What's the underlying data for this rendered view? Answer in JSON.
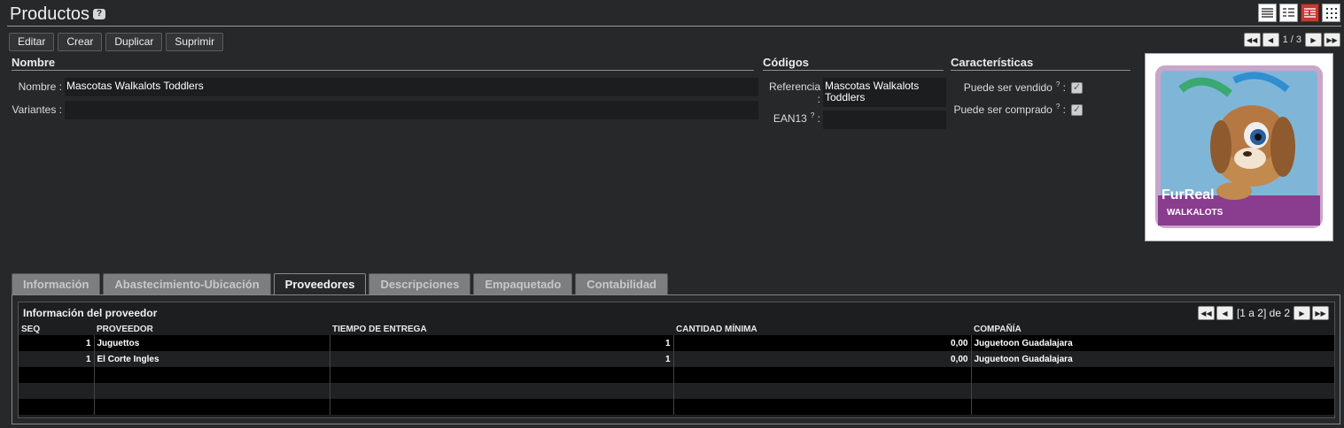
{
  "page": {
    "title": "Productos",
    "help": "?"
  },
  "toolbar": {
    "edit": "Editar",
    "create": "Crear",
    "duplicate": "Duplicar",
    "delete": "Suprimir"
  },
  "pager": {
    "text": "1 / 3"
  },
  "sections": {
    "name": "Nombre",
    "codes": "Códigos",
    "features": "Características"
  },
  "fields": {
    "name_label": "Nombre :",
    "name_value": "Mascotas Walkalots Toddlers",
    "variants_label": "Variantes :",
    "variants_value": "",
    "reference_label": "Referencia :",
    "reference_value_1": "Mascotas Walkalots",
    "reference_value_2": "Toddlers",
    "ean_label": "EAN13",
    "ean_colon": ":",
    "ean_value": "",
    "can_sell_label": "Puede ser vendido",
    "can_buy_label": "Puede ser comprado",
    "help_mark": "?",
    "colon": ":"
  },
  "tabs": [
    "Información",
    "Abastecimiento-Ubicación",
    "Proveedores",
    "Descripciones",
    "Empaquetado",
    "Contabilidad"
  ],
  "supplier": {
    "title": "Información del proveedor",
    "pager_text": "[1 a 2] de 2",
    "columns": [
      "SEQ",
      "PROVEEDOR",
      "TIEMPO DE ENTREGA",
      "CANTIDAD MÍNIMA",
      "COMPAÑÍA"
    ],
    "rows": [
      {
        "seq": "1",
        "provider": "Juguettos",
        "lead": "1",
        "min_qty": "0,00",
        "company": "Juguetoon Guadalajara"
      },
      {
        "seq": "1",
        "provider": "El Corte Ingles",
        "lead": "1",
        "min_qty": "0,00",
        "company": "Juguetoon Guadalajara"
      }
    ]
  },
  "image": {
    "brand_text": "FurReal",
    "sub_text": "WALKALOTS"
  }
}
